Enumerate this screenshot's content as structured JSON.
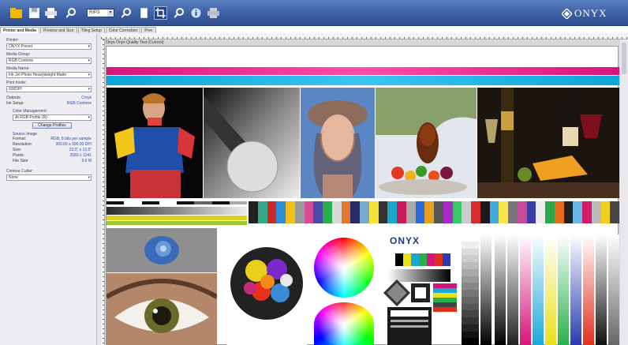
{
  "toolbar": {
    "zoom_value": "RIP3",
    "logo_text": "ONYX",
    "colors": {
      "toolbar_bg": "#3a5fa4",
      "accent": "#f0b000"
    },
    "icons": [
      "open-folder-icon",
      "save-icon",
      "print-icon",
      "search-icon",
      "zoom-dropdown",
      "zoom-in-icon",
      "page-icon",
      "crop-icon",
      "zoom-out-icon",
      "info-icon",
      "printer-icon"
    ]
  },
  "tabs": [
    {
      "label": "Printer and Media",
      "active": true
    },
    {
      "label": "Preview and Size",
      "active": false
    },
    {
      "label": "Tiling Setup",
      "active": false
    },
    {
      "label": "Color Correction",
      "active": false
    },
    {
      "label": "Prev",
      "active": false
    }
  ],
  "panel": {
    "printer_label": "Printer:",
    "printer_value": "ONYX Preset",
    "media_group_label": "Media Group:",
    "media_group_value": "RGB Contone",
    "media_name_label": "Media Name:",
    "media_name_value": "Ink Jet Photo Heavyweight Matte",
    "print_mode_label": "Print mode:",
    "print_mode_value": "600DPI",
    "outputs_label": "Outputs:",
    "outputs_value": "Cmyk",
    "ink_setup_label": "Ink Setup:",
    "ink_setup_value": "RGB Contone",
    "color_mgmt_label": "Color Management:",
    "color_mgmt_value": "At RGB Profile (R)",
    "change_profiles_button": "Change Profiles",
    "source_image_label": "Source Image",
    "format_label": "Format:",
    "format_value": "RGB, 8 bits per sample",
    "resolution_label": "Resolution:",
    "resolution_value": "300.00 x 300.00 DPI",
    "size_label": "Size:",
    "size_value": "23.0\" x 13.5\"",
    "pixels_label": "Pixels:",
    "pixels_value": "2583 x 1241",
    "file_size_label": "File Size:",
    "file_size_value": "9.6 M",
    "contour_cutter_label": "Contour Cutter:",
    "contour_cutter_value": "None"
  },
  "canvas": {
    "doc_title": "Onyx Onyx Quality Test (Current)",
    "onyx_label": "ONYX"
  }
}
